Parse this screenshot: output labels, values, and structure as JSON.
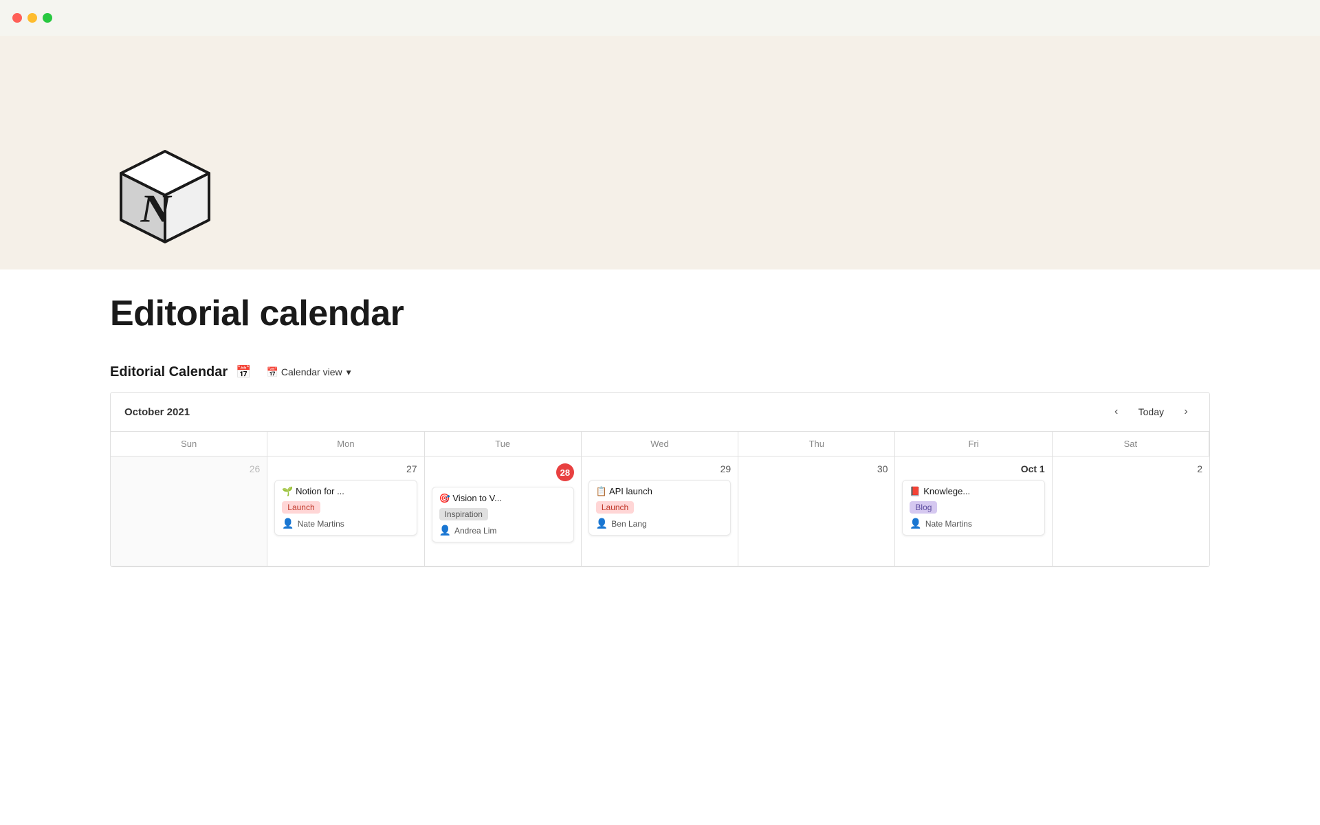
{
  "window": {
    "traffic_lights": {
      "red_label": "close",
      "yellow_label": "minimize",
      "green_label": "maximize"
    }
  },
  "page": {
    "title": "Editorial calendar",
    "db_title": "Editorial Calendar",
    "view_label": "📅 Calendar view",
    "cover_bg": "#f5f0e8"
  },
  "calendar": {
    "month_label": "October 2021",
    "today_label": "Today",
    "nav_prev": "‹",
    "nav_next": "›",
    "day_headers": [
      "Sun",
      "Mon",
      "Tue",
      "Wed",
      "Thu",
      "Fri",
      "Sat"
    ],
    "week_row": [
      {
        "date": "26",
        "outside": true,
        "is_today": false,
        "events": []
      },
      {
        "date": "27",
        "outside": false,
        "is_today": false,
        "events": [
          {
            "icon": "🌱",
            "title": "Notion for ...",
            "tag": "Launch",
            "tag_class": "tag-launch",
            "assignee_icon": "👤",
            "assignee": "Nate Martins"
          }
        ]
      },
      {
        "date": "28",
        "outside": false,
        "is_today": true,
        "events": [
          {
            "icon": "🎯",
            "title": "Vision to V...",
            "tag": "Inspiration",
            "tag_class": "tag-inspiration",
            "assignee_icon": "👤",
            "assignee": "Andrea Lim"
          }
        ]
      },
      {
        "date": "29",
        "outside": false,
        "is_today": false,
        "events": [
          {
            "icon": "📋",
            "title": "API launch",
            "tag": "Launch",
            "tag_class": "tag-launch",
            "assignee_icon": "👤",
            "assignee": "Ben Lang"
          }
        ]
      },
      {
        "date": "30",
        "outside": false,
        "is_today": false,
        "events": []
      },
      {
        "date": "Oct 1",
        "outside": false,
        "is_today": false,
        "is_oct1": true,
        "events": [
          {
            "icon": "📕",
            "title": "Knowlege...",
            "tag": "Blog",
            "tag_class": "tag-blog",
            "assignee_icon": "👤",
            "assignee": "Nate Martins"
          }
        ]
      },
      {
        "date": "2",
        "outside": false,
        "is_today": false,
        "events": []
      }
    ]
  },
  "footer_card": {
    "text": "Notion for Launch Nate Martins"
  }
}
